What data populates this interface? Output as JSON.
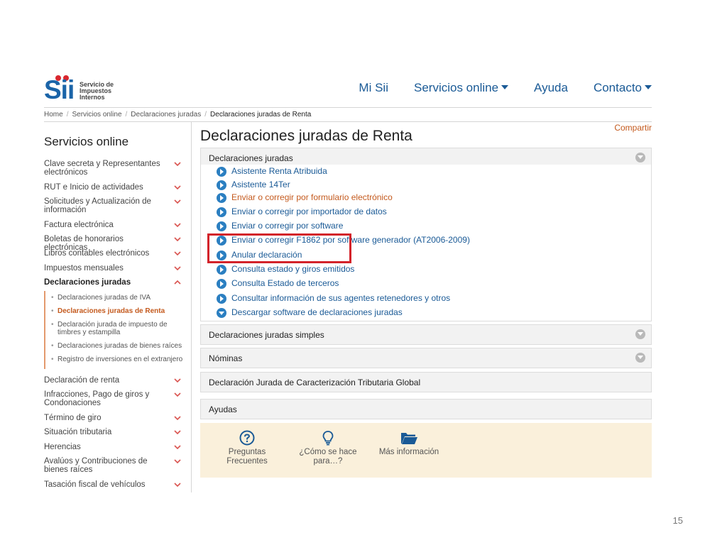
{
  "header": {
    "logo_mark": "Sii",
    "logo_lines": [
      "Servicio de",
      "Impuestos",
      "Internos"
    ],
    "nav": [
      {
        "label": "Mi Sii",
        "dropdown": false
      },
      {
        "label": "Servicios online",
        "dropdown": true
      },
      {
        "label": "Ayuda",
        "dropdown": false
      },
      {
        "label": "Contacto",
        "dropdown": true
      }
    ]
  },
  "breadcrumb": [
    "Home",
    "Servicios online",
    "Declaraciones juradas",
    "Declaraciones juradas de Renta"
  ],
  "sidebar": {
    "title": "Servicios online",
    "items": [
      {
        "label": "Clave secreta y Representantes electrónicos"
      },
      {
        "label": "RUT e Inicio de actividades"
      },
      {
        "label": "Solicitudes y Actualización de información"
      },
      {
        "label": "Factura electrónica"
      },
      {
        "label": "Boletas de honorarios electrónicas"
      },
      {
        "label": "Libros contables electrónicos"
      },
      {
        "label": "Impuestos mensuales"
      },
      {
        "label": "Declaraciones juradas"
      },
      {
        "label": "Declaración de renta"
      },
      {
        "label": "Infracciones, Pago de giros y Condonaciones"
      },
      {
        "label": "Término de giro"
      },
      {
        "label": "Situación tributaria"
      },
      {
        "label": "Herencias"
      },
      {
        "label": "Avalúos y Contribuciones de bienes raíces"
      },
      {
        "label": "Tasación fiscal de vehículos"
      }
    ],
    "subitems": [
      {
        "label": "Declaraciones juradas de IVA"
      },
      {
        "label": "Declaraciones juradas de Renta"
      },
      {
        "label": "Declaración jurada de impuesto de timbres y estampilla"
      },
      {
        "label": "Declaraciones juradas de bienes raíces"
      },
      {
        "label": "Registro de inversiones en el extranjero"
      }
    ]
  },
  "main": {
    "title": "Declaraciones juradas de Renta",
    "share": "Compartir",
    "panel1": {
      "label": "Declaraciones juradas",
      "links": [
        "Asistente Renta Atribuida",
        "Asistente 14Ter",
        "Enviar o corregir por formulario electrónico",
        "Enviar o corregir por importador de datos",
        "Enviar o corregir por software",
        "Enviar o corregir F1862 por software generador (AT2006-2009)",
        "Anular declaración",
        "Consulta estado y giros emitidos",
        "Consulta Estado de terceros",
        "Consultar información de sus agentes retenedores y otros",
        "Descargar software de declaraciones juradas"
      ]
    },
    "panel2": {
      "label": "Declaraciones juradas simples"
    },
    "panel3": {
      "label": "Nóminas"
    },
    "panel4": {
      "label": "Declaración Jurada de Caracterización Tributaria Global"
    },
    "panel5": {
      "label": "Ayudas"
    },
    "aids": [
      {
        "line1": "Preguntas",
        "line2": "Frecuentes",
        "icon": "question-circle-icon"
      },
      {
        "line1": "¿Cómo se hace",
        "line2": "para…?",
        "icon": "lightbulb-icon"
      },
      {
        "line1": "Más información",
        "line2": "",
        "icon": "folder-open-icon"
      }
    ]
  },
  "slide_number": "15",
  "colors": {
    "link": "#1a5a96",
    "accent_orange": "#c45a1e",
    "highlight_red": "#d3232a",
    "logo_blue": "#1b64a8",
    "aid_bg": "#faf0db"
  }
}
